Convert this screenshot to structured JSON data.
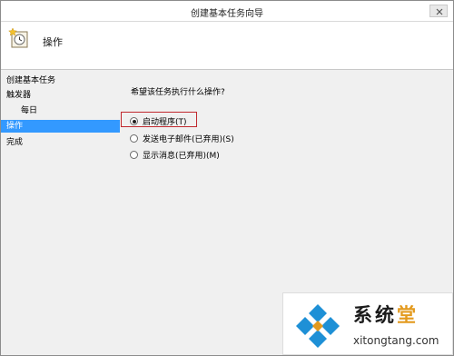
{
  "window": {
    "title": "创建基本任务向导"
  },
  "header": {
    "title": "操作"
  },
  "sidebar": {
    "items": [
      {
        "label": "创建基本任务"
      },
      {
        "label": "触发器"
      },
      {
        "label": "每日"
      },
      {
        "label": "操作"
      },
      {
        "label": "完成"
      }
    ]
  },
  "content": {
    "question": "希望该任务执行什么操作?",
    "options": [
      {
        "label": "启动程序(T)",
        "checked": true
      },
      {
        "label": "发送电子邮件(已弃用)(S)",
        "checked": false
      },
      {
        "label": "显示消息(已弃用)(M)",
        "checked": false
      }
    ]
  },
  "watermark": {
    "text_prefix": "系统",
    "text_highlight": "堂",
    "url": "xitongtang.com"
  },
  "colors": {
    "selection": "#3399ff",
    "highlight_border": "#c0282e",
    "logo_blue": "#1e90d6",
    "logo_accent": "#e39a1e"
  }
}
